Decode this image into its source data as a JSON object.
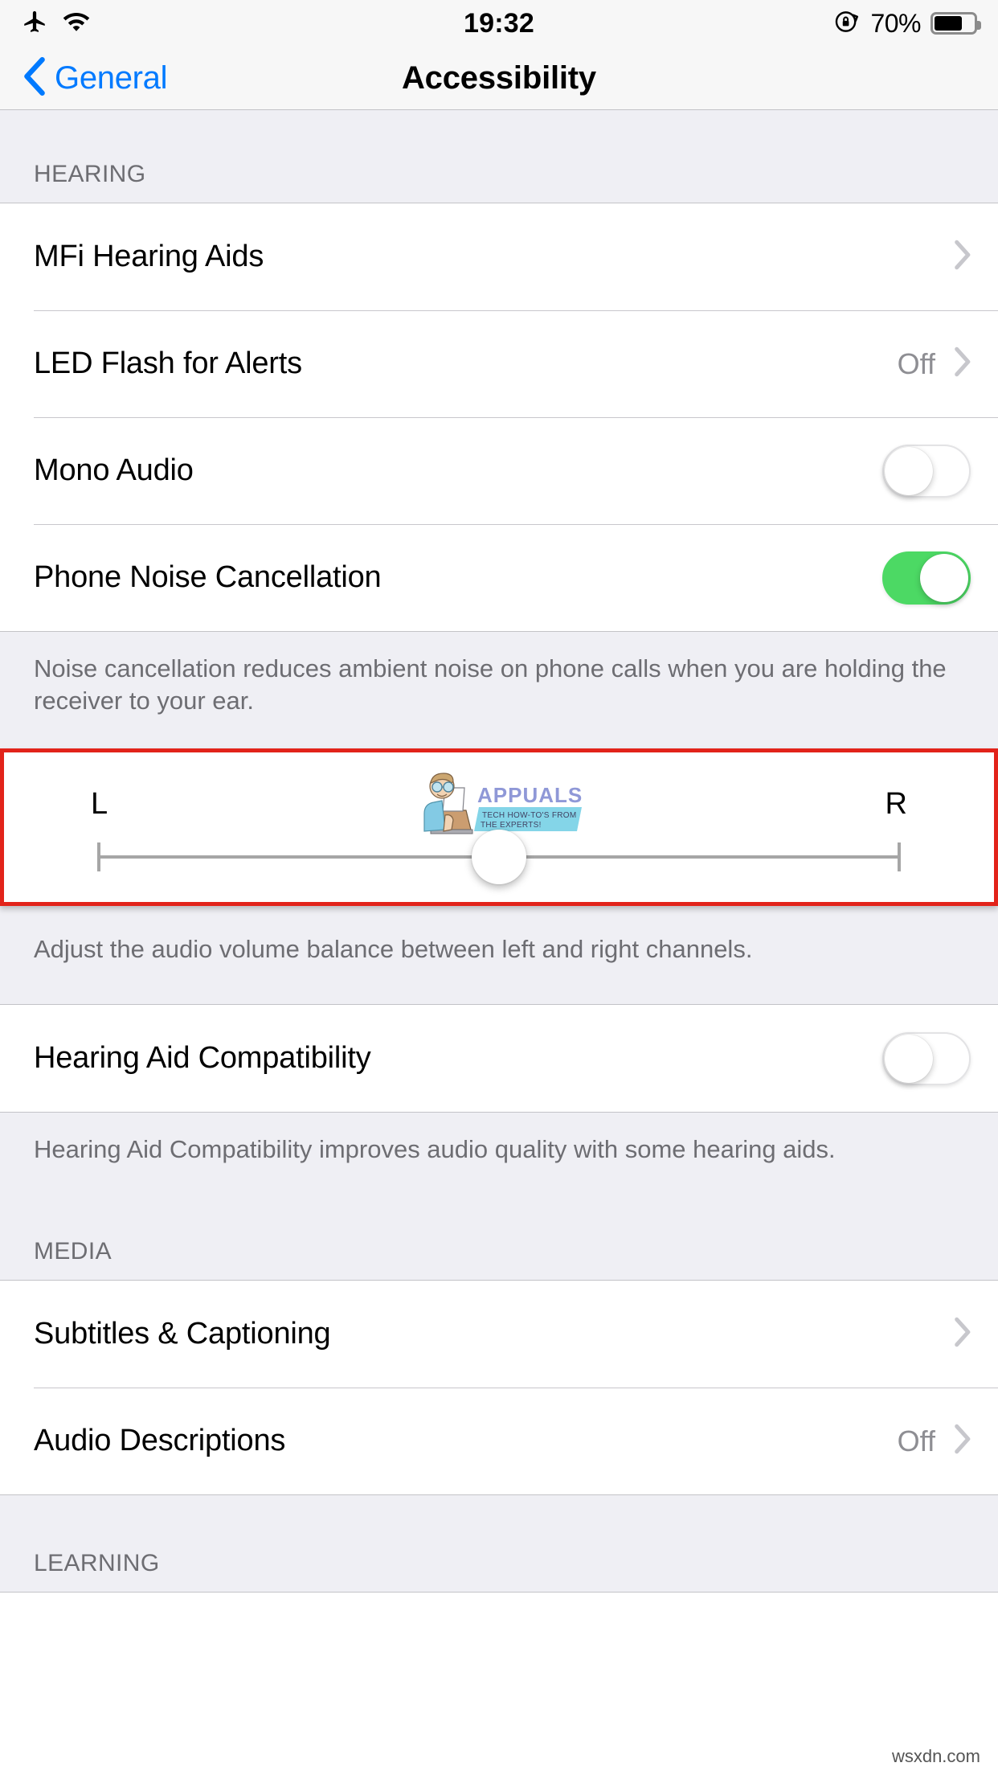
{
  "status_bar": {
    "airplane_icon": "airplane-icon",
    "wifi_icon": "wifi-icon",
    "time": "19:32",
    "rotation_lock_icon": "rotation-lock-icon",
    "battery_percent": "70%",
    "battery_level": 70
  },
  "nav": {
    "back_label": "General",
    "title": "Accessibility",
    "back_chevron_icon": "chevron-left-icon",
    "tint_color": "#007aff"
  },
  "sections": {
    "hearing": {
      "header": "HEARING",
      "rows": [
        {
          "label": "MFi Hearing Aids",
          "value": "",
          "type": "disclosure"
        },
        {
          "label": "LED Flash for Alerts",
          "value": "Off",
          "type": "disclosure"
        },
        {
          "label": "Mono Audio",
          "value": "",
          "type": "switch",
          "on": false
        },
        {
          "label": "Phone Noise Cancellation",
          "value": "",
          "type": "switch",
          "on": true
        }
      ],
      "footer": "Noise cancellation reduces ambient noise on phone calls when you are holding the receiver to your ear."
    },
    "balance": {
      "left_label": "L",
      "right_label": "R",
      "value": 0.5,
      "footer": "Adjust the audio volume balance between left and right channels.",
      "highlight_color": "#e2231a"
    },
    "hearing_aid": {
      "rows": [
        {
          "label": "Hearing Aid Compatibility",
          "value": "",
          "type": "switch",
          "on": false
        }
      ],
      "footer": "Hearing Aid Compatibility improves audio quality with some hearing aids."
    },
    "media": {
      "header": "MEDIA",
      "rows": [
        {
          "label": "Subtitles & Captioning",
          "value": "",
          "type": "disclosure"
        },
        {
          "label": "Audio Descriptions",
          "value": "Off",
          "type": "disclosure"
        }
      ]
    },
    "learning": {
      "header": "LEARNING"
    }
  },
  "watermarks": {
    "appuals_title": "APPUALS",
    "appuals_tagline_line1": "TECH HOW-TO'S FROM",
    "appuals_tagline_line2": "THE EXPERTS!",
    "site": "wsxdn.com"
  },
  "switch_colors": {
    "on": "#4cd964",
    "off_border": "#e3e3e5"
  }
}
